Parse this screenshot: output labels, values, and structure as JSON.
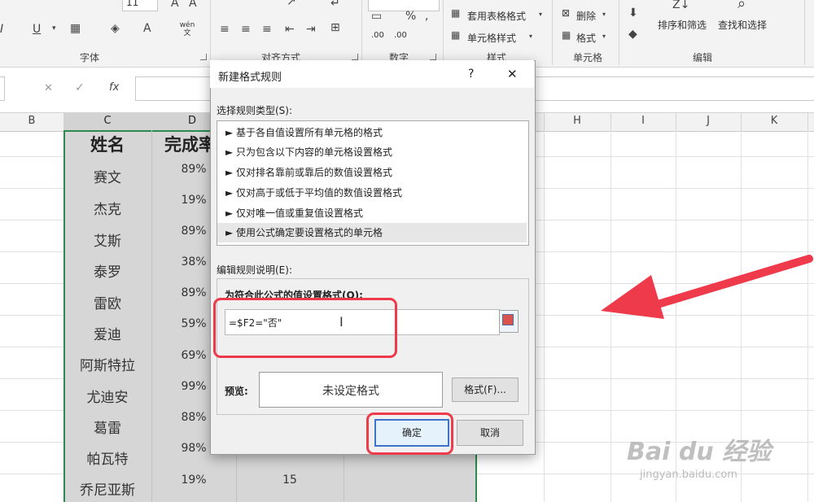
{
  "ribbon": {
    "font_size_value": "11",
    "groups": {
      "font": "字体",
      "alignment": "对齐方式",
      "number": "数字",
      "styles": "样式",
      "cells": "单元格",
      "editing": "编辑"
    },
    "styles_items": [
      "套用表格格式",
      "单元格样式"
    ],
    "cells_items": [
      "删除",
      "格式"
    ],
    "editing_items": [
      "排序和筛选",
      "查找和选择"
    ],
    "percent": "%",
    "comma": ",",
    "dec_inc": ".00",
    "dec_dec": ".00",
    "wen_icon": "wén 文",
    "bold_u": "U"
  },
  "formula_bar": {
    "cancel": "✕",
    "enter": "✓",
    "fx": "fx"
  },
  "columns": [
    "B",
    "C",
    "D",
    "H",
    "I",
    "J",
    "K"
  ],
  "sheet": {
    "header_name": "姓名",
    "header_rate": "完成率",
    "rows": [
      {
        "name": "赛文",
        "rate": "89%"
      },
      {
        "name": "杰克",
        "rate": "19%"
      },
      {
        "name": "艾斯",
        "rate": "89%"
      },
      {
        "name": "泰罗",
        "rate": "38%"
      },
      {
        "name": "雷欧",
        "rate": "89%"
      },
      {
        "name": "爱迪",
        "rate": "59%"
      },
      {
        "name": "阿斯特拉",
        "rate": "69%"
      },
      {
        "name": "尤迪安",
        "rate": "99%"
      },
      {
        "name": "葛雷",
        "rate": "88%"
      },
      {
        "name": "帕瓦特",
        "rate": "98%"
      },
      {
        "name": "乔尼亚斯",
        "rate": "19%",
        "extra": "15"
      }
    ]
  },
  "dialog": {
    "title": "新建格式规则",
    "help": "?",
    "close": "✕",
    "rule_type_label": "选择规则类型(S):",
    "rule_types": [
      "► 基于各自值设置所有单元格的格式",
      "► 只为包含以下内容的单元格设置格式",
      "► 仅对排名靠前或靠后的数值设置格式",
      "► 仅对高于或低于平均值的数值设置格式",
      "► 仅对唯一值或重复值设置格式",
      "► 使用公式确定要设置格式的单元格"
    ],
    "edit_label": "编辑规则说明(E):",
    "formula_label": "为符合此公式的值设置格式(O):",
    "formula_value": "=$F2=\"否\"",
    "preview_label": "预览:",
    "preview_text": "未设定格式",
    "format_button": "格式(F)...",
    "ok_button": "确定",
    "cancel_button": "取消"
  },
  "watermark": {
    "brand": "Bai du 经验",
    "url": "jingyan.baidu.com"
  },
  "colors": {
    "accent_red": "#ee3a4a",
    "excel_green": "#2a8a4f",
    "selection_gray": "#d6d6d6"
  }
}
